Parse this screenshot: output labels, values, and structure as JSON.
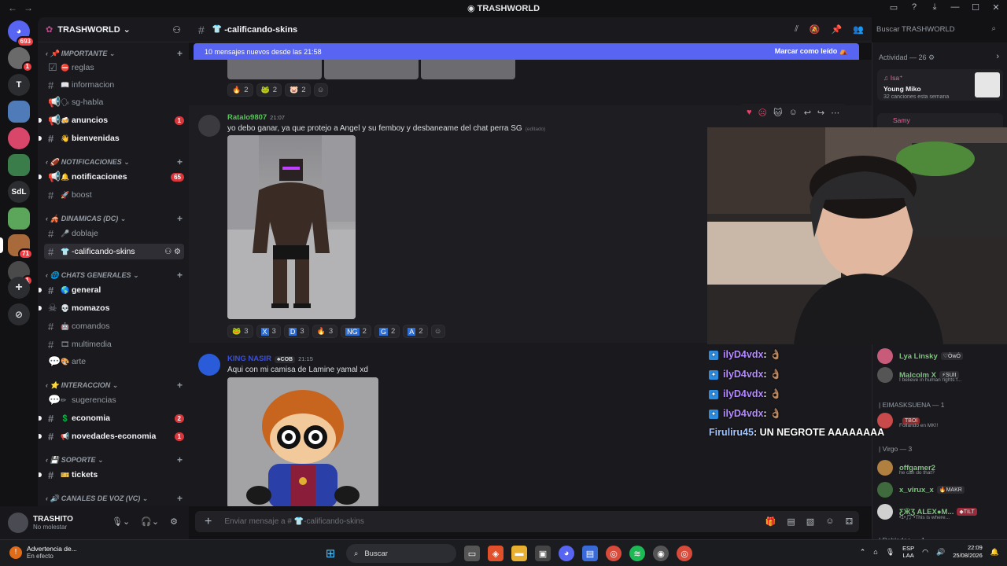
{
  "window": {
    "title": "TRASHWORLD"
  },
  "rail": {
    "home_badge": "693",
    "servers": [
      {
        "name": "server-1",
        "badge": "1",
        "color": "#6a6a6a"
      },
      {
        "name": "server-T",
        "label": "T",
        "color": "#2b2d31"
      },
      {
        "name": "server-3",
        "color": "#4f7bb8"
      },
      {
        "name": "server-4",
        "color": "#d8466a"
      },
      {
        "name": "server-5",
        "color": "#3b7d4a"
      },
      {
        "name": "server-SdL",
        "label": "SdL",
        "color": "#2b2d31"
      },
      {
        "name": "server-7",
        "color": "#5ba65a"
      },
      {
        "name": "server-trashworld",
        "badge": "71",
        "color": "#a86a3a"
      },
      {
        "name": "server-9",
        "badge": "1",
        "color": "#4a4a4a"
      }
    ]
  },
  "sidebar": {
    "server_name": "TRASHWORLD",
    "categories": [
      {
        "label": "IMPORTANTE"
      },
      {
        "label": "NOTIFICACIONES"
      },
      {
        "label": "DINAMICAS (DC)"
      },
      {
        "label": "CHATS GENERALES"
      },
      {
        "label": "INTERACCION"
      },
      {
        "label": "SOPORTE"
      },
      {
        "label": "CANALES DE VOZ (VC)"
      }
    ],
    "channels": {
      "reglas": "reglas",
      "informacion": "informacion",
      "sg_habla": "sg-habla",
      "anuncios": "anuncios",
      "anuncios_badge": "1",
      "bienvenidas": "bienvenidas",
      "notificaciones": "notificaciones",
      "notificaciones_badge": "65",
      "boost": "boost",
      "doblaje": "doblaje",
      "calificando": "-calificando-skins",
      "general": "general",
      "momazos": "momazos",
      "comandos": "comandos",
      "multimedia": "multimedia",
      "arte": "arte",
      "sugerencias": "sugerencias",
      "economia": "economia",
      "economia_badge": "2",
      "novedades": "novedades-economia",
      "novedades_badge": "1",
      "tickets": "tickets"
    }
  },
  "user": {
    "name": "TRASHITO",
    "status": "No molestar"
  },
  "channel_header": {
    "name": "-calificando-skins",
    "search_placeholder": "Buscar TRASHWORLD"
  },
  "new_messages": {
    "text": "10 mensajes nuevos desde las 21:58",
    "action": "Marcar como leído"
  },
  "messages": [
    {
      "reactions": [
        {
          "emoji": "🔥",
          "count": "2"
        },
        {
          "emoji": "🐸",
          "count": "2"
        },
        {
          "emoji": "🐷",
          "count": "2"
        }
      ]
    },
    {
      "author": "Ratalo9807",
      "author_color": "#57c35a",
      "time": "21:07",
      "text": "yo debo ganar, ya que protejo a Angel y su femboy y desbaneame del chat perra SG",
      "edited": "(editado)",
      "reactions": [
        {
          "emoji": "🐸",
          "count": "3"
        },
        {
          "emoji": "X",
          "count": "3"
        },
        {
          "emoji": "D",
          "count": "3"
        },
        {
          "emoji": "🔥",
          "count": "3"
        },
        {
          "emoji": "NG",
          "count": "2"
        },
        {
          "emoji": "G",
          "count": "2"
        },
        {
          "emoji": "A",
          "count": "2"
        }
      ]
    },
    {
      "author": "KING NASIR",
      "author_color": "#3a4fd8",
      "tag": "COB",
      "time": "21:15",
      "text": "Aqui con mi camisa de Lamine yamal xd"
    }
  ],
  "composer": {
    "placeholder": "Enviar mensaje a # 👕-calificando-skins"
  },
  "activity": {
    "title": "Actividad — 26",
    "card": {
      "user": "Isa⁺",
      "song": "Young Miko",
      "sub": "32 canciones esta semana"
    },
    "card2_user": "Samy"
  },
  "members": [
    {
      "name": "Lya Linsky",
      "tag": "ÒwÓ",
      "color": "#7ec27e",
      "avatar": "#c85a7a"
    },
    {
      "name": "Malcolm X",
      "tag": "SUII",
      "color": "#7ec27e",
      "sub": "I believe in human rights f...",
      "avatar": "#555"
    },
    {
      "role": "| EIMASKSUENA — 1"
    },
    {
      "name": "TBOI",
      "tag": "",
      "color": "#e05a6a",
      "sub": "Follando en MK!!",
      "avatar": "#c84a4a"
    },
    {
      "role": "| Virgo — 3"
    },
    {
      "name": "offgamer2",
      "color": "#7ec27e",
      "sub": "he can do that?",
      "avatar": "#b08040"
    },
    {
      "name": "x_virux_x",
      "tag": "MAKR",
      "color": "#7ec27e",
      "avatar": "#3e6a3e"
    },
    {
      "name": "ƸӜƷ ALEX●M...",
      "tag": "TILT",
      "color": "#7ec27e",
      "sub": "•1•🎵 •This is where...",
      "avatar": "#d0d0d0"
    },
    {
      "role": "| Dobladoe — 1"
    }
  ],
  "stream_chat": [
    {
      "user": "ilyD4vdx",
      "msg": ": 👌🏽"
    },
    {
      "user": "ilyD4vdx",
      "msg": ": 👌🏽"
    },
    {
      "user": "ilyD4vdx",
      "msg": ": 👌🏽"
    },
    {
      "user": "ilyD4vdx",
      "msg": ": 👌🏽"
    },
    {
      "user": "Firuliru45",
      "msg": ": UN NEGROTE AAAAAAAA"
    }
  ],
  "taskbar": {
    "warning_title": "Advertencia de...",
    "warning_sub": "En efecto",
    "search": "Buscar",
    "lang1": "ESP",
    "lang2": "LAA",
    "time": "22:09",
    "date": "25/08/2026"
  }
}
